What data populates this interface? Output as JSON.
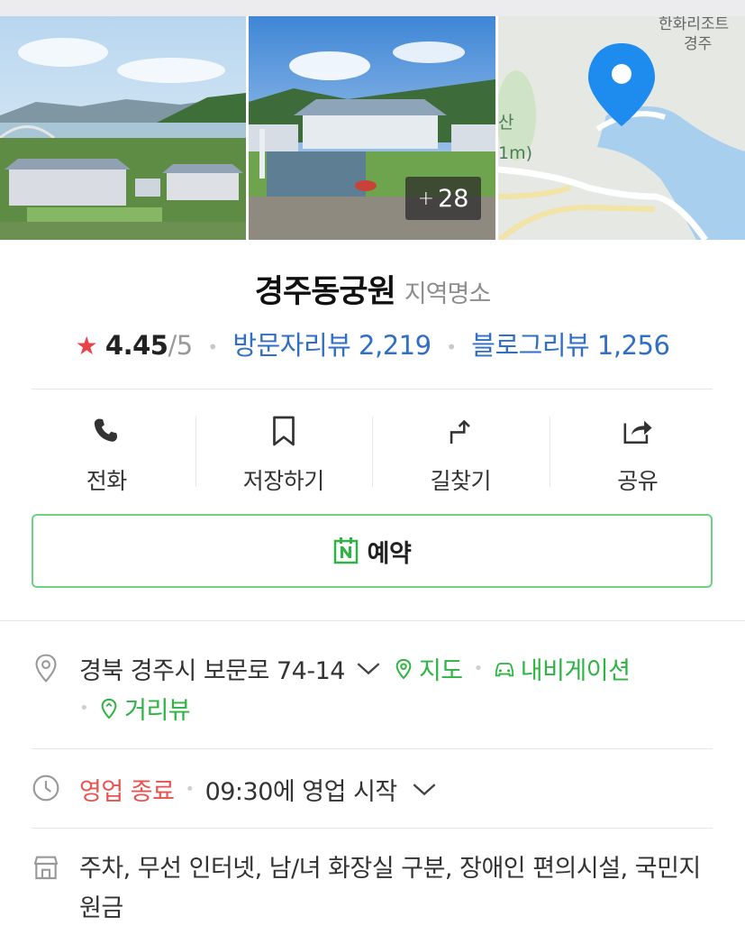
{
  "gallery": {
    "more_count": "28",
    "map_labels": {
      "resort": "한화리조트",
      "city": "경주",
      "mountain": "산",
      "elevation": "1m)"
    }
  },
  "place": {
    "name": "경주동궁원",
    "category": "지역명소"
  },
  "rating": {
    "score": "4.45",
    "max": "/5",
    "visitor_review_label": "방문자리뷰 2,219",
    "blog_review_label": "블로그리뷰 1,256"
  },
  "actions": [
    {
      "label": "전화",
      "icon": "phone-icon"
    },
    {
      "label": "저장하기",
      "icon": "bookmark-icon"
    },
    {
      "label": "길찾기",
      "icon": "directions-icon"
    },
    {
      "label": "공유",
      "icon": "share-icon"
    }
  ],
  "reserve": {
    "label": "예약",
    "icon": "naver-calendar-icon"
  },
  "address": {
    "text": "경북 경주시 보문로 74-14",
    "map_link": "지도",
    "navigation_link": "내비게이션",
    "streetview_link": "거리뷰"
  },
  "hours": {
    "status": "영업 종료",
    "detail": "09:30에 영업 시작"
  },
  "amenities": {
    "text": "주차, 무선 인터넷, 남/녀 화장실 구분, 장애인 편의시설, 국민지원금"
  },
  "colors": {
    "accent_green": "#2db442",
    "link_blue": "#2f6fc5",
    "star_red": "#e9424a",
    "closed_red": "#e8524f",
    "border_green": "#6dd283"
  }
}
